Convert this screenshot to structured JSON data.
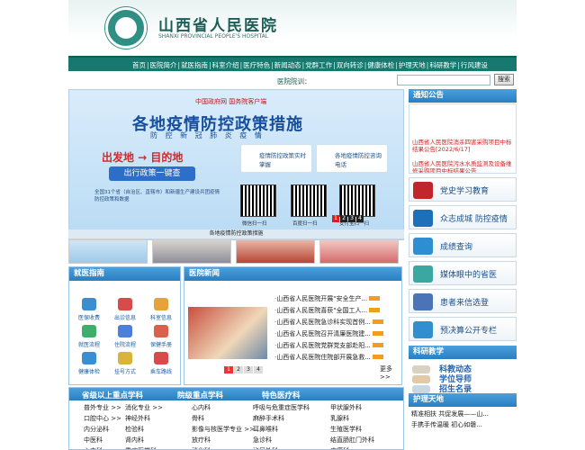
{
  "header": {
    "title": "山西省人民医院",
    "subtitle": "SHANXI PROVINCIAL PEOPLE'S HOSPITAL"
  },
  "nav": {
    "items": [
      "首页",
      "医院简介",
      "就医指南",
      "科室介绍",
      "医疗特色",
      "新闻动态",
      "党群工作",
      "双向转诊",
      "健康体检",
      "护理天地",
      "科研教学",
      "行风建设"
    ]
  },
  "searchbar": {
    "label": "医院院训：",
    "button": "搜索"
  },
  "banner": {
    "gov": "中国政府网  国务院客户端",
    "title": "各地疫情防控政策措施",
    "subtitle": "防 控 新 冠 肺 炎 疫 情",
    "from_to": "出发地 → 目的地",
    "query_btn": "出行政策一键查",
    "coverage": "全国31个省（自治区、直辖市）和新疆生产建设兵团疫情防控政策和数据",
    "card1": "疫情防控政策实时掌握",
    "card2": "各地疫情防控咨询电话",
    "qr1": "微信扫一扫",
    "qr2": "百度扫一扫",
    "qr3": "支付宝扫一扫",
    "caption": "各地疫情防控政策措施",
    "pager": [
      "1",
      "2",
      "3",
      "4"
    ]
  },
  "notice": {
    "title": "通知公告",
    "items": [
      "山西省人民医院消杀四害采购项目中标结果公告[2022/6/17]",
      "山西省人民医院污水水质监测及设备维修采购项目中标结果公告"
    ]
  },
  "side_links": [
    "党史学习教育",
    "众志成城 防控疫情",
    "成绩查询",
    "媒体眼中的省医",
    "患者来信选登",
    "预决算公开专栏"
  ],
  "guide": {
    "title": "就医指南",
    "items": [
      "医保收费",
      "出诊信息",
      "科室信息",
      "就医流程",
      "住院流程",
      "保健手册",
      "健康体检",
      "挂号方式",
      "乘车路线"
    ]
  },
  "news": {
    "title": "医院新闻",
    "items": [
      "山西省人民医院开展\"安全生产...",
      "山西省人民医院喜获\"全国工人...",
      "山西省人民医院急诊科实现首例...",
      "山西省人民医院召开清廉医院建...",
      "山西省人民医院党群党支部赴阳...",
      "山西省人民医院住院部开展急救..."
    ],
    "more": "更多>>",
    "pager": [
      "1",
      "2",
      "3",
      "4"
    ]
  },
  "specialties": {
    "tabs": [
      "省级以上重点学科",
      "院级重点学科",
      "特色医疗科"
    ],
    "col1": [
      "普外专业 >>",
      "口腔中心 >>",
      "内分泌科",
      "中医科",
      "心内科"
    ],
    "col2": [
      "消化专业 >>",
      "神经外科",
      "检验科",
      "肾内科",
      "重症医学科"
    ],
    "col3": [
      "心内科",
      "骨科",
      "影像与核医学专业 >>",
      "放疗科",
      "消化科"
    ],
    "col4": [
      "呼吸与危重症医学科",
      "麻醉手术科",
      "耳鼻喉科",
      "急诊科",
      "泌尿外科"
    ],
    "col5": [
      "甲状腺外科",
      "乳腺科",
      "生殖医学科",
      "结直肠肛门外科",
      "疼痛科"
    ]
  },
  "edu": {
    "title": "科研教学",
    "items": [
      "科教动态",
      "学位导师",
      "招生名录"
    ]
  },
  "nursing": {
    "title": "护理天地",
    "items": [
      "精准相扶 共促发展——山...",
      "手携手传温暖 初心如磐..."
    ]
  }
}
